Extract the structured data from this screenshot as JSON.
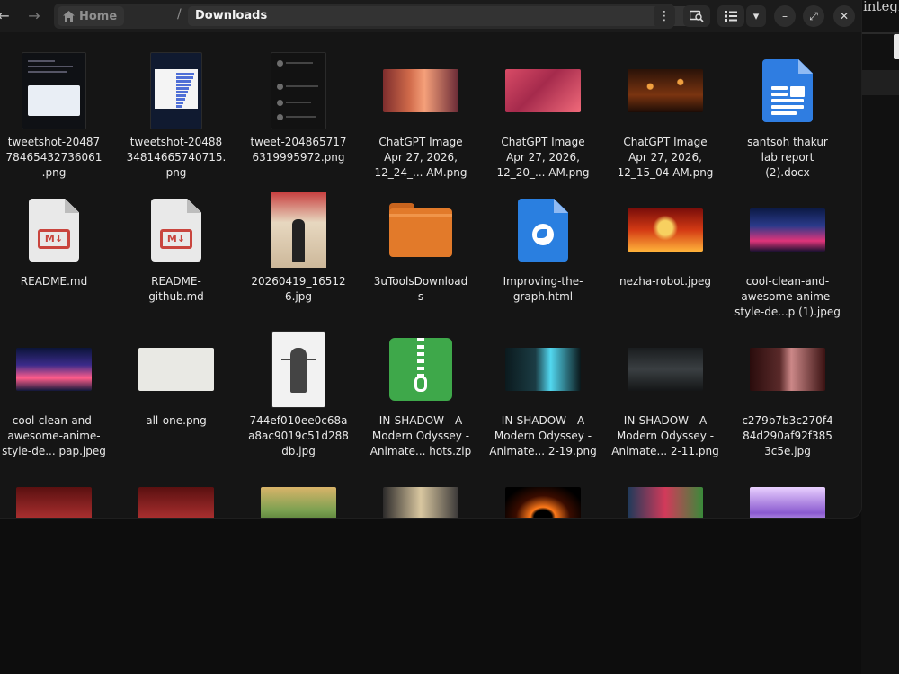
{
  "background_app": {
    "text": "integra"
  },
  "header": {
    "home_label": "Home",
    "separator": "/",
    "current_folder": "Downloads",
    "back_icon": "arrow-left-icon",
    "forward_icon": "arrow-right-icon",
    "menu_glyph": "⋮",
    "view_dropdown_glyph": "▾",
    "minimize_glyph": "–",
    "maximize_glyph": "⤢",
    "close_glyph": "✕"
  },
  "files": [
    {
      "name": "tweetshot-20487\n78465432736061\n.png",
      "thumb": "shot-dark"
    },
    {
      "name": "tweetshot-20488\n34814665740715.\npng",
      "thumb": "shot-blue"
    },
    {
      "name": "tweet-204865717\n6319995972.png",
      "thumb": "shot-tweet"
    },
    {
      "name": "ChatGPT Image\nApr 27, 2026,\n12_24_...  AM.png",
      "thumb": "g-sunset"
    },
    {
      "name": "ChatGPT Image\nApr 27, 2026,\n12_20_...  AM.png",
      "thumb": "g-red"
    },
    {
      "name": "ChatGPT Image\nApr 27, 2026,\n12_15_04 AM.png",
      "thumb": "g-lanterns"
    },
    {
      "name": "santsoh thakur\nlab report\n(2).docx",
      "thumb": "word"
    },
    {
      "name": "README.md",
      "thumb": "md",
      "badge": "M↓"
    },
    {
      "name": "README-\ngithub.md",
      "thumb": "md",
      "badge": "M↓"
    },
    {
      "name": "20260419_16512\n6.jpg",
      "thumb": "photo"
    },
    {
      "name": "3uToolsDownload\ns",
      "thumb": "folder"
    },
    {
      "name": "Improving-the-\ngraph.html",
      "thumb": "html"
    },
    {
      "name": "nezha-robot.jpeg",
      "thumb": "g-robot"
    },
    {
      "name": "cool-clean-and-\nawesome-anime-\nstyle-de...p (1).jpeg",
      "thumb": "g-city"
    },
    {
      "name": "cool-clean-and-\nawesome-anime-\nstyle-de... pap.jpeg",
      "thumb": "g-anime2"
    },
    {
      "name": "all-one.png",
      "thumb": "g-allone"
    },
    {
      "name": "744ef010ee0c68a\na8ac9019c51d288\ndb.jpg",
      "thumb": "sketch"
    },
    {
      "name": "IN-SHADOW - A\nModern Odyssey -\nAnimate... hots.zip",
      "thumb": "zip"
    },
    {
      "name": "IN-SHADOW - A\nModern Odyssey -\nAnimate... 2-19.png",
      "thumb": "g-shadow1"
    },
    {
      "name": "IN-SHADOW - A\nModern Odyssey -\nAnimate...  2-11.png",
      "thumb": "g-shadow2"
    },
    {
      "name": "c279b7b3c270f4\n84d290af92f385\n3c5e.jpg",
      "thumb": "g-c279"
    },
    {
      "name": "",
      "thumb": "g-red2"
    },
    {
      "name": "",
      "thumb": "g-red2"
    },
    {
      "name": "",
      "thumb": "g-field"
    },
    {
      "name": "",
      "thumb": "g-blonde"
    },
    {
      "name": "",
      "thumb": "g-blackhole"
    },
    {
      "name": "",
      "thumb": "g-faces"
    },
    {
      "name": "",
      "thumb": "g-purple"
    }
  ]
}
